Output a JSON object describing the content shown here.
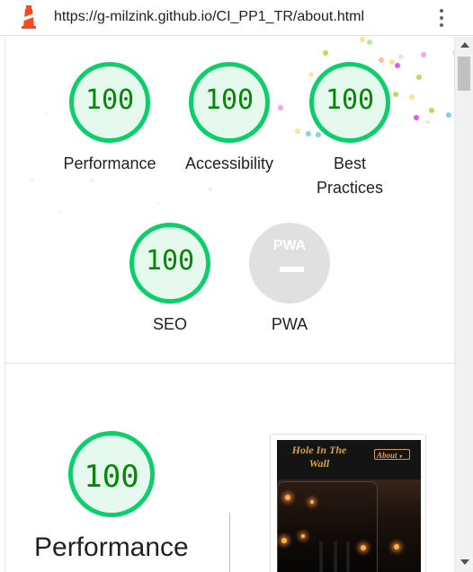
{
  "browser": {
    "url": "https://g-milzink.github.io/CI_PP1_TR/about.html",
    "logo_icon": "lighthouse-icon",
    "menu_icon": "kebab-menu-icon"
  },
  "colors": {
    "pass_ring": "#0cce6b",
    "pass_fill": "#e6f9ee",
    "pass_text": "#008800",
    "na_fill": "#e0e0e0"
  },
  "summary": {
    "gauges": [
      {
        "label": "Performance",
        "score": "100"
      },
      {
        "label": "Accessibility",
        "score": "100"
      },
      {
        "label": "Best Practices",
        "score": "100"
      },
      {
        "label": "SEO",
        "score": "100"
      }
    ],
    "pwa": {
      "label": "PWA",
      "badge": "PWA",
      "score_display": "—"
    }
  },
  "performance_section": {
    "score": "100",
    "title": "Performance"
  },
  "screenshot": {
    "site_title": "Hole In The Wall",
    "nav_select": "About"
  }
}
